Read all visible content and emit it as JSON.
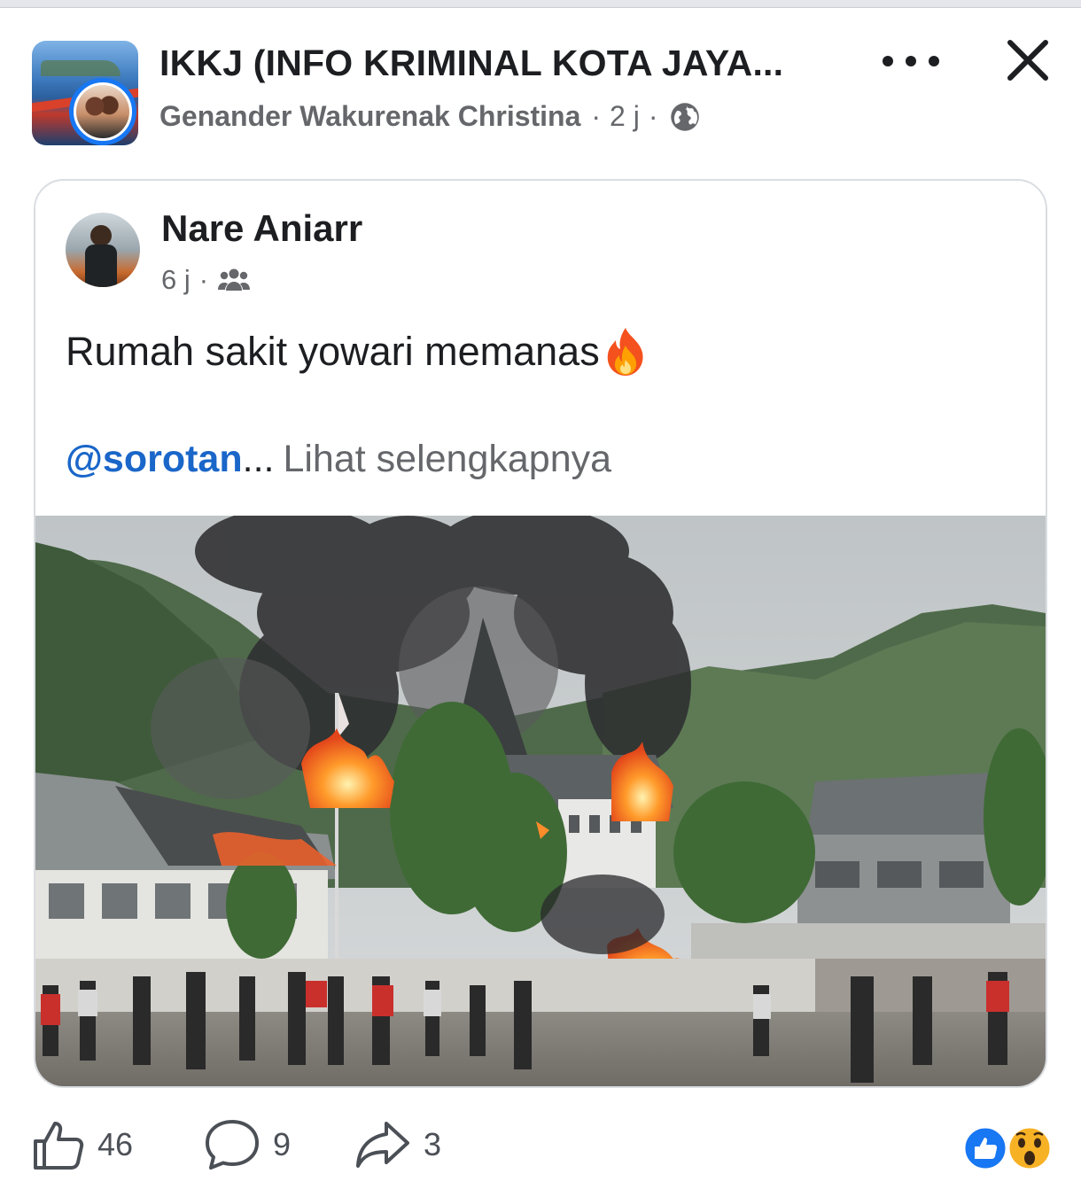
{
  "header": {
    "group_name": "IKKJ (INFO KRIMINAL KOTA JAYA...",
    "poster_name": "Genander Wakurenak Christina",
    "time": "2 j",
    "separator": "·",
    "audience_icon": "globe-icon",
    "more_icon": "more-options-icon",
    "close_icon": "close-icon"
  },
  "shared_post": {
    "author_name": "Nare Aniarr",
    "time": "6 j",
    "separator": "·",
    "audience_icon": "friends-icon",
    "text": "Rumah sakit yowari memanas",
    "emoji": "fire-emoji",
    "mention": "@sorotan",
    "ellipsis": "...",
    "see_more_label": "Lihat selengkapnya",
    "image": "hospital-fire-photo"
  },
  "footer": {
    "like_count": "46",
    "comment_count": "9",
    "share_count": "3",
    "reaction_icons": [
      "like-reaction-icon",
      "wow-reaction-icon"
    ]
  },
  "colors": {
    "accent": "#1877f2",
    "mention": "#1a66c9",
    "secondary_text": "#65676b",
    "border": "#dadde1"
  }
}
